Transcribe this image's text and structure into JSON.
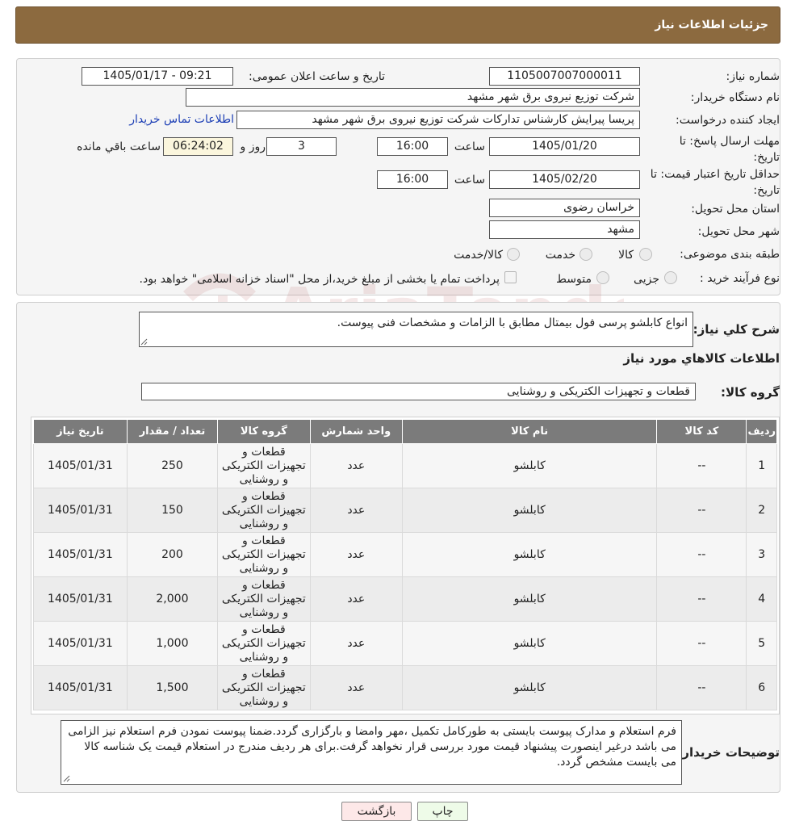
{
  "header": {
    "title": "جزئیات اطلاعات نیاز"
  },
  "form": {
    "need_number_label": "شماره نیاز:",
    "need_number": "1105007007000011",
    "announce_label": "تاریخ و ساعت اعلان عمومی:",
    "announce_value": "1405/01/17 - 09:21",
    "buyer_org_label": "نام دستگاه خریدار:",
    "buyer_org": "شرکت توزیع نیروی برق شهر مشهد",
    "creator_label": "ایجاد کننده درخواست:",
    "creator": "پریسا پیرایش کارشناس تدارکات شرکت توزیع نیروی برق شهر مشهد",
    "contact_link": "اطلاعات تماس خریدار",
    "deadline_label_1": "مهلت ارسال پاسخ: تا",
    "deadline_label_2": "تاریخ:",
    "deadline_date": "1405/01/20",
    "time_label": "ساعت",
    "deadline_time": "16:00",
    "days_value": "3",
    "days_label": "روز و",
    "remaining_value": "06:24:02",
    "remaining_label": "ساعت باقي مانده",
    "validity_label_1": "حداقل تاریخ اعتبار قیمت: تا",
    "validity_label_2": "تاریخ:",
    "validity_date": "1405/02/20",
    "validity_time": "16:00",
    "province_label": "استان محل تحویل:",
    "province": "خراسان رضوی",
    "city_label": "شهر محل تحویل:",
    "city": "مشهد",
    "category_label": "طبقه بندی موضوعی:",
    "category_options": [
      "کالا",
      "خدمت",
      "کالا/خدمت"
    ],
    "purchase_type_label": "نوع فرآیند خرید :",
    "purchase_options": [
      "جزیی",
      "متوسط"
    ],
    "payment_note": "پرداخت تمام یا بخشی از مبلغ خرید،از محل \"اسناد خزانه اسلامی\" خواهد بود."
  },
  "watermark": {
    "text": "AriaTender.neT"
  },
  "description": {
    "label": "شرح کلي نياز:",
    "value": "انواع کابلشو پرسی فول بیمتال مطابق با الزامات و مشخصات فنی پیوست."
  },
  "goods_info_title": "اطلاعات کالاهاي مورد نياز",
  "goods_group": {
    "label": "گروه کالا:",
    "value": "قطعات و تجهیزات الکتریکی و روشنایی"
  },
  "table": {
    "headers": [
      "رديف",
      "کد کالا",
      "نام کالا",
      "واحد شمارش",
      "گروه کالا",
      "تعداد / مقدار",
      "تاریخ نیاز"
    ],
    "rows": [
      [
        "1",
        "--",
        "کابلشو",
        "عدد",
        "قطعات و تجهیزات الکتریکی و روشنایی",
        "250",
        "1405/01/31"
      ],
      [
        "2",
        "--",
        "کابلشو",
        "عدد",
        "قطعات و تجهیزات الکتریکی و روشنایی",
        "150",
        "1405/01/31"
      ],
      [
        "3",
        "--",
        "کابلشو",
        "عدد",
        "قطعات و تجهیزات الکتریکی و روشنایی",
        "200",
        "1405/01/31"
      ],
      [
        "4",
        "--",
        "کابلشو",
        "عدد",
        "قطعات و تجهیزات الکتریکی و روشنایی",
        "2,000",
        "1405/01/31"
      ],
      [
        "5",
        "--",
        "کابلشو",
        "عدد",
        "قطعات و تجهیزات الکتریکی و روشنایی",
        "1,000",
        "1405/01/31"
      ],
      [
        "6",
        "--",
        "کابلشو",
        "عدد",
        "قطعات و تجهیزات الکتریکی و روشنایی",
        "1,500",
        "1405/01/31"
      ]
    ]
  },
  "buyer_notes": {
    "label": "توضیحات خریدار:",
    "value": "فرم استعلام و مدارک پیوست بایستی به طورکامل تکمیل ،مهر وامضا و بارگزاری گردد.ضمنا پیوست نمودن فرم استعلام نیز الزامی می باشد درغیر اینصورت پیشنهاد قیمت مورد بررسی قرار نخواهد گرفت.برای هر ردیف مندرج در استعلام قیمت یک شناسه کالا می بایست مشخص گردد."
  },
  "buttons": {
    "print": "چاپ",
    "back": "بازگشت"
  },
  "colors": {
    "header": "#8c6a3f",
    "link": "#1d3fb5",
    "table_header": "#7b7b7b",
    "back_button": "#fde8e8",
    "print_button": "#eefbe8"
  }
}
